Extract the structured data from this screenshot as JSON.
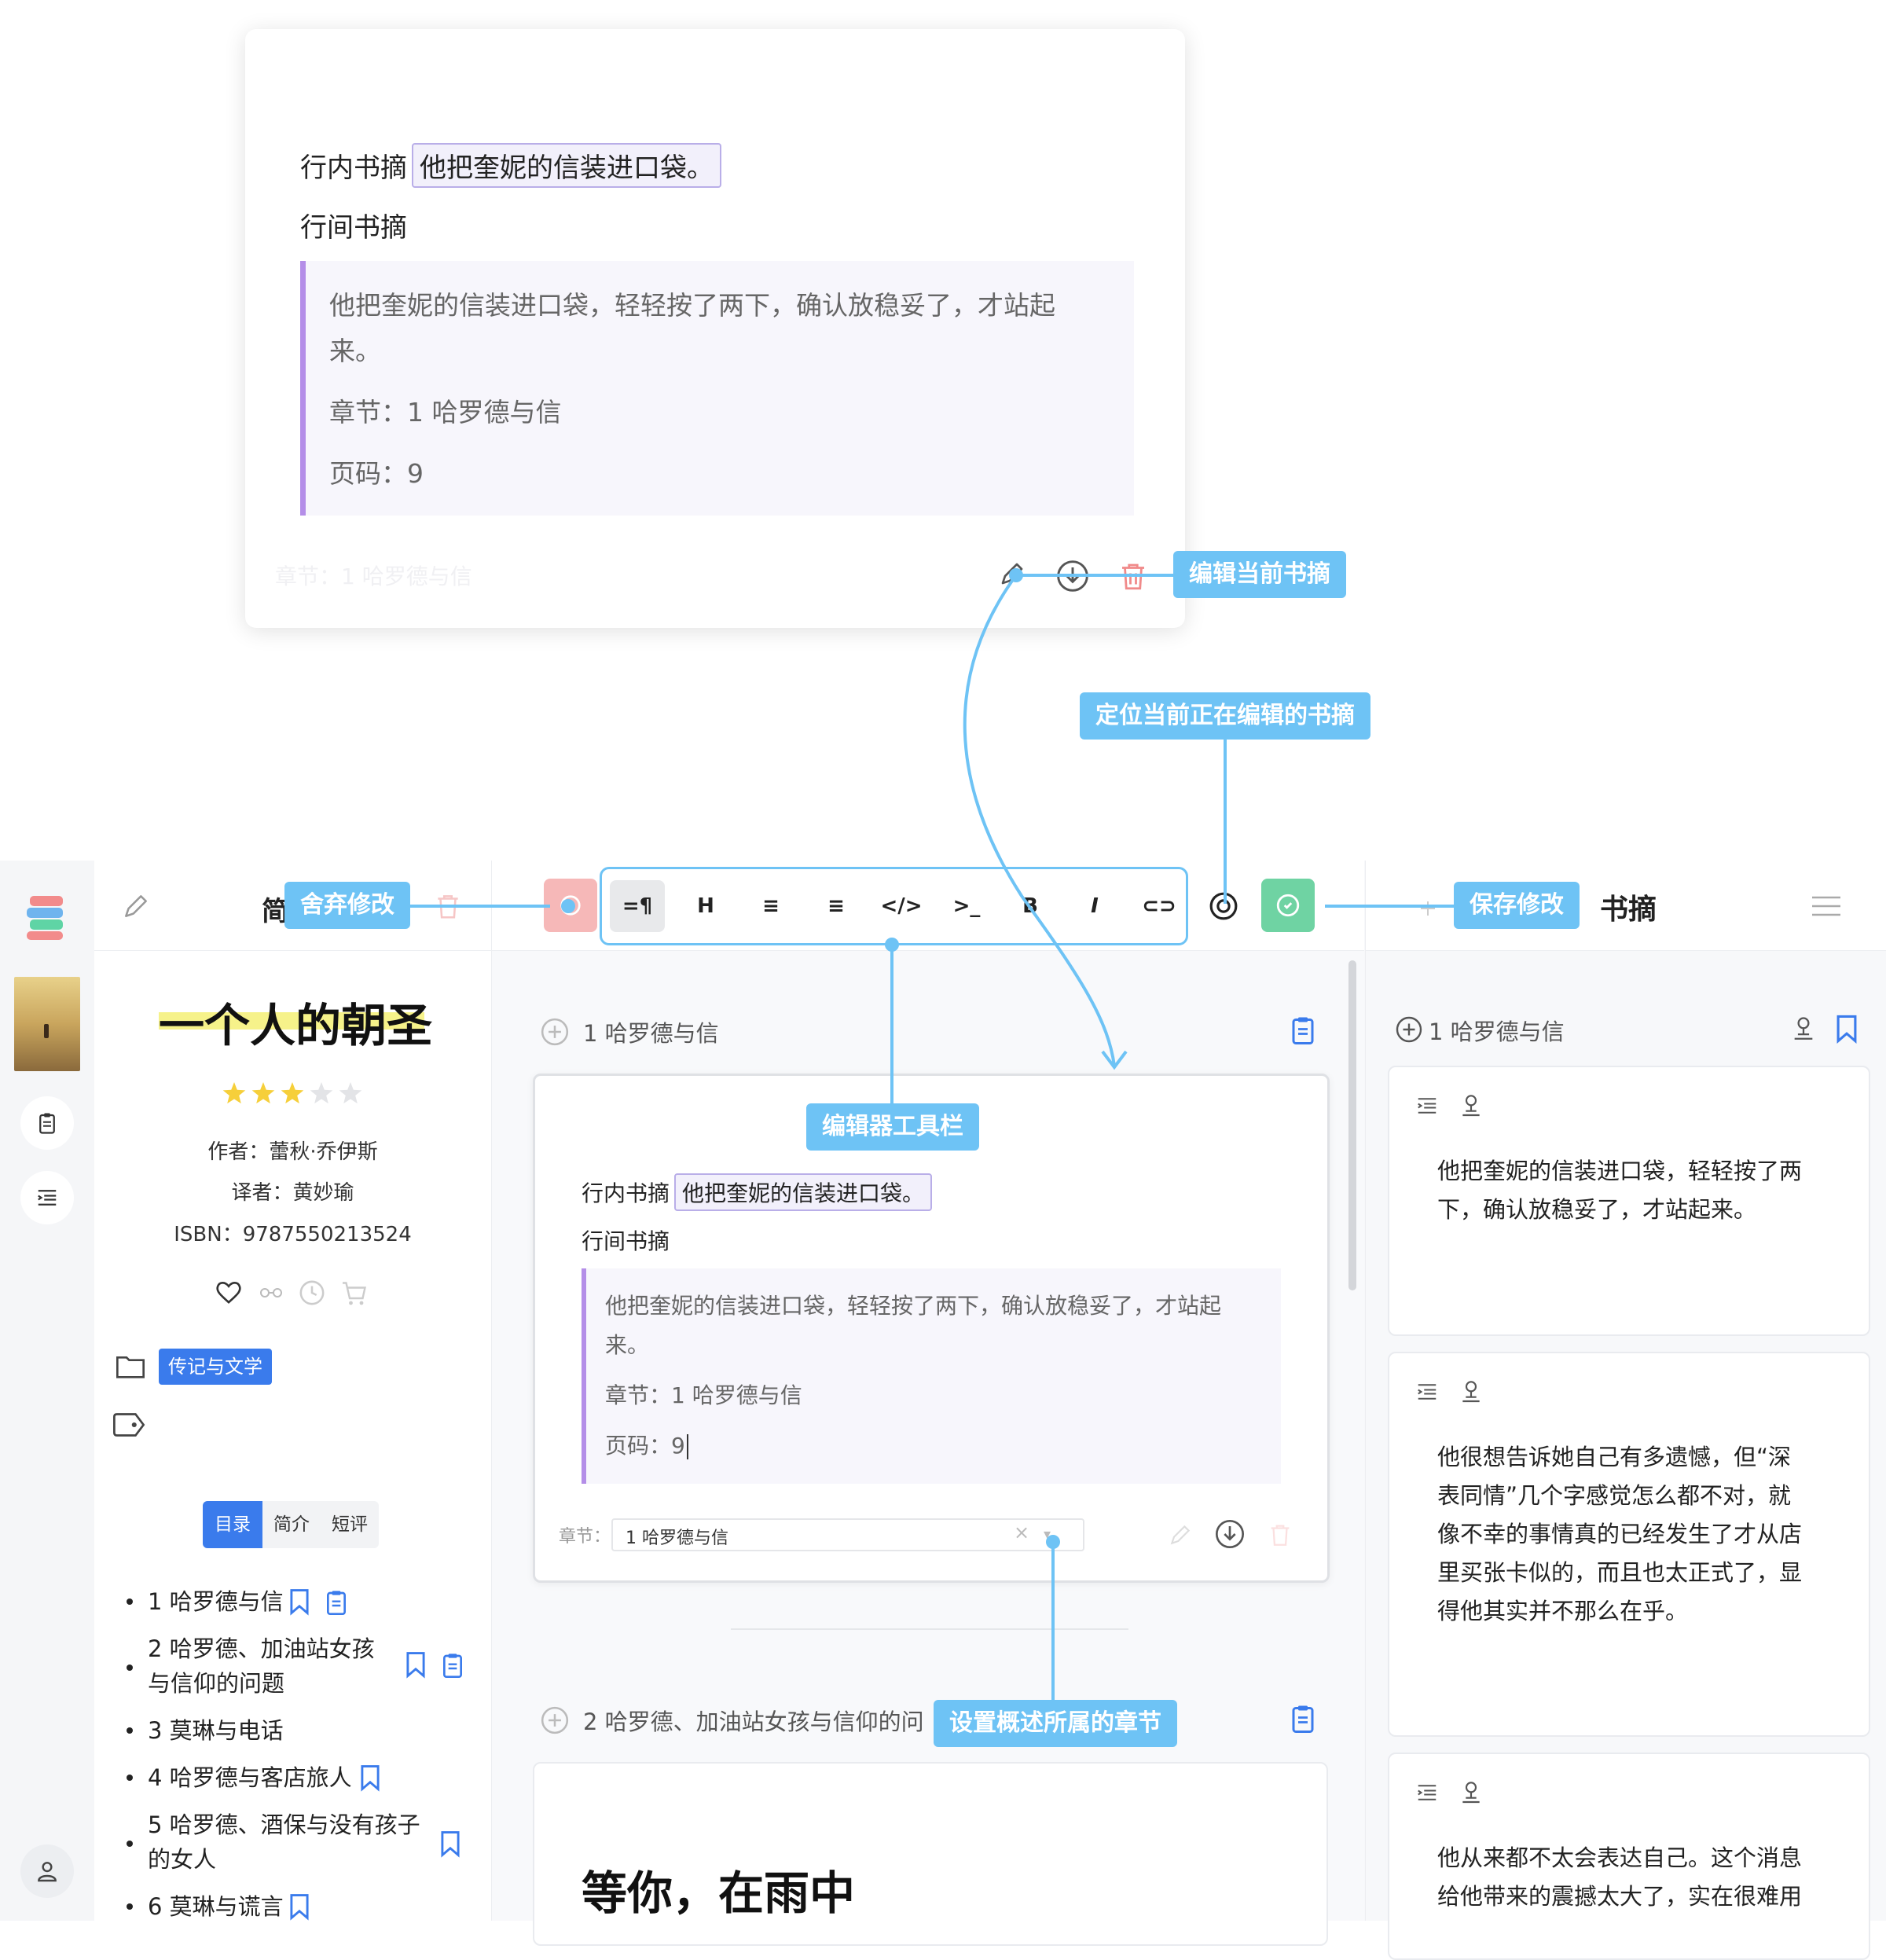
{
  "preview": {
    "inline_label": "行内书摘",
    "inline_quote": "他把奎妮的信装进口袋。",
    "block_label": "行间书摘",
    "quote_line1": "他把奎妮的信装进口袋，轻轻按了两下，确认放稳妥了，才站起",
    "quote_line2": "来。",
    "chapter": "章节：1 哈罗德与信",
    "page": "页码：9",
    "faded_footer": "章节：1 哈罗德与信"
  },
  "callouts": {
    "edit_current": "编辑当前书摘",
    "locate_editing": "定位当前正在编辑的书摘",
    "discard": "舍弃修改",
    "save": "保存修改",
    "toolbar": "编辑器工具栏",
    "set_chapter": "设置概述所属的章节"
  },
  "book": {
    "section_title": "简",
    "title": "一个人的朝圣",
    "rating": 3,
    "max_rating": 5,
    "author": "作者：蕾秋·乔伊斯",
    "translator": "译者：黄妙瑜",
    "isbn": "ISBN：9787550213524",
    "category_tag": "传记与文学",
    "tabs": [
      "目录",
      "简介",
      "短评"
    ],
    "toc": [
      {
        "line1": "1 哈罗德与信",
        "line2": ""
      },
      {
        "line1": "2 哈罗德、加油站女孩",
        "line2": "与信仰的问题"
      },
      {
        "line1": "3 莫琳与电话",
        "line2": ""
      },
      {
        "line1": "4 哈罗德与客店旅人",
        "line2": ""
      },
      {
        "line1": "5 哈罗德、酒保与没有孩子",
        "line2": "的女人"
      },
      {
        "line1": "6 莫琳与谎言",
        "line2": ""
      }
    ]
  },
  "editor": {
    "toolbar_buttons": [
      "=¶",
      "H",
      "≡",
      "≡",
      "</>",
      ">_",
      "B",
      "I",
      "⊂⊃"
    ],
    "chapter1_heading": "1 哈罗德与信",
    "inline_label": "行内书摘",
    "inline_quote": "他把奎妮的信装进口袋。",
    "block_label": "行间书摘",
    "quote_line1": "他把奎妮的信装进口袋，轻轻按了两下，确认放稳妥了，才站起",
    "quote_line2": "来。",
    "chapter": "章节：1 哈罗德与信",
    "page": "页码：9",
    "chapter_field_label": "章节：",
    "chapter_field_value": "1 哈罗德与信",
    "chapter2_heading": "2 哈罗德、加油站女孩与信仰的问",
    "next_card_heading": "等你，在雨中"
  },
  "notes": {
    "title": "书摘",
    "chapter_heading": "1 哈罗德与信",
    "items": [
      {
        "lines": [
          "他把奎妮的信装进口袋，轻轻按了两",
          "下，确认放稳妥了，才站起来。"
        ]
      },
      {
        "lines": [
          "他很想告诉她自己有多遗憾，但“深",
          "表同情”几个字感觉怎么都不对，就",
          "像不幸的事情真的已经发生了才从店",
          "里买张卡似的，而且也太正式了，显",
          "得他其实并不那么在乎。"
        ]
      },
      {
        "lines": [
          "他从来都不太会表达自己。这个消息",
          "给他带来的震撼太大了，实在很难用"
        ]
      }
    ]
  },
  "colors": {
    "accent_blue": "#3a7bec",
    "callout_blue": "#6ec3f5",
    "quote_border": "#b48ee8",
    "discard_red": "#f6b8b8",
    "save_green": "#6fd3a3",
    "delete_red": "#f08a8a",
    "star_yellow": "#f6cf3a"
  }
}
